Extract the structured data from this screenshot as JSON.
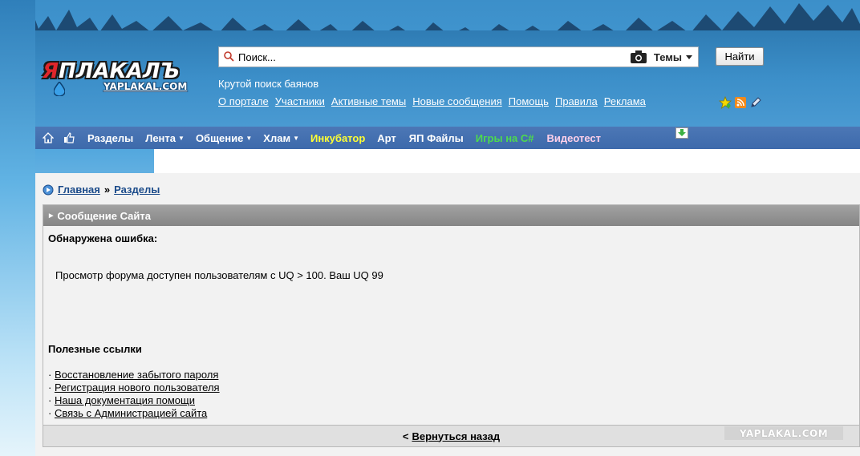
{
  "logo": {
    "first_letter": "Я",
    "rest": "ПЛАКАЛЪ",
    "sub": "YAPLAKAL.COM"
  },
  "search": {
    "placeholder": "Поиск...",
    "scope": "Темы",
    "button": "Найти",
    "hint": "Крутой поиск баянов"
  },
  "top_links": [
    "О портале",
    "Участники",
    "Активные темы",
    "Новые сообщения",
    "Помощь",
    "Правила",
    "Реклама"
  ],
  "nav": {
    "items": [
      {
        "label": "Разделы",
        "color": "#ffffff",
        "caret": ""
      },
      {
        "label": "Лента",
        "color": "#ffffff",
        "caret": "▼"
      },
      {
        "label": "Общение",
        "color": "#ffffff",
        "caret": "▼"
      },
      {
        "label": "Хлам",
        "color": "#ffffff",
        "caret": "▼"
      },
      {
        "label": "Инкубатор",
        "color": "#ffff33",
        "caret": ""
      },
      {
        "label": "Арт",
        "color": "#ffffff",
        "caret": ""
      },
      {
        "label": "ЯП Файлы",
        "color": "#ffffff",
        "caret": ""
      },
      {
        "label": "Игры на C#",
        "color": "#4ddb4d",
        "caret": ""
      },
      {
        "label": "Видеотест",
        "color": "#ffd0ea",
        "caret": ""
      }
    ]
  },
  "breadcrumb": {
    "home": "Главная",
    "sep": "»",
    "sections": "Разделы"
  },
  "message": {
    "header": "Сообщение Сайта",
    "error_title": "Обнаружена ошибка:",
    "error_text": "Просмотр форума доступен пользователям с UQ > 100. Ваш UQ 99",
    "links_title": "Полезные ссылки",
    "links": [
      "Восстановление забытого пароля",
      "Регистрация нового пользователя",
      "Наша документация помощи",
      "Связь с Администрацией сайта"
    ],
    "back_prefix": "<",
    "back_label": "Вернуться назад"
  },
  "watermark": "YAPLAKAL.COM",
  "colors": {
    "header_blue": "#3c8fc9",
    "nav_blue": "#4c77b6",
    "link_blue": "#1b4b8a"
  }
}
